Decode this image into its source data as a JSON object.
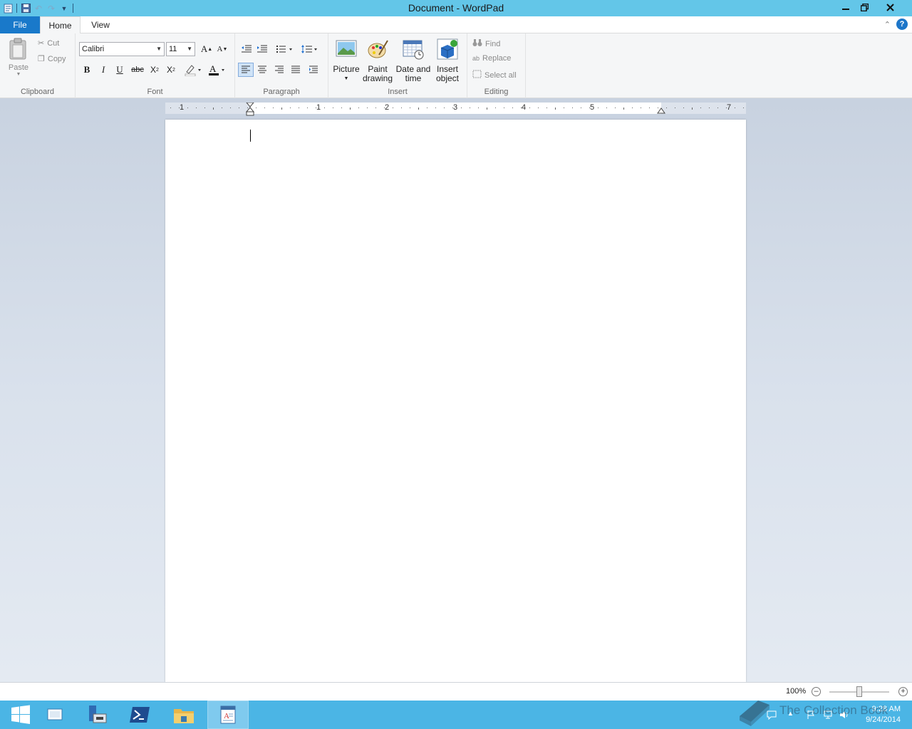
{
  "window": {
    "title": "Document - WordPad",
    "minimize_icon": "minimize-icon",
    "restore_icon": "restore-icon",
    "close_icon": "close-icon"
  },
  "tabs": {
    "file": "File",
    "home": "Home",
    "view": "View"
  },
  "ribbon": {
    "clipboard": {
      "label": "Clipboard",
      "paste": "Paste",
      "cut": "Cut",
      "copy": "Copy"
    },
    "font": {
      "label": "Font",
      "family": "Calibri",
      "size": "11"
    },
    "paragraph": {
      "label": "Paragraph"
    },
    "insert": {
      "label": "Insert",
      "picture": "Picture",
      "paint_line1": "Paint",
      "paint_line2": "drawing",
      "date_line1": "Date and",
      "date_line2": "time",
      "object_line1": "Insert",
      "object_line2": "object"
    },
    "editing": {
      "label": "Editing",
      "find": "Find",
      "replace": "Replace",
      "select_all": "Select all"
    }
  },
  "ruler": {
    "numbers": [
      "1",
      "1",
      "2",
      "3",
      "4",
      "5",
      "7"
    ]
  },
  "status": {
    "zoom": "100%",
    "zoom_fraction": 0.5
  },
  "taskbar": {
    "time": "9:28 AM",
    "date": "9/24/2014",
    "watermark": "The Collection Book"
  },
  "colors": {
    "titlebar": "#63c6e8",
    "file_tab": "#1979ca",
    "taskbar": "#4bb5e5"
  }
}
